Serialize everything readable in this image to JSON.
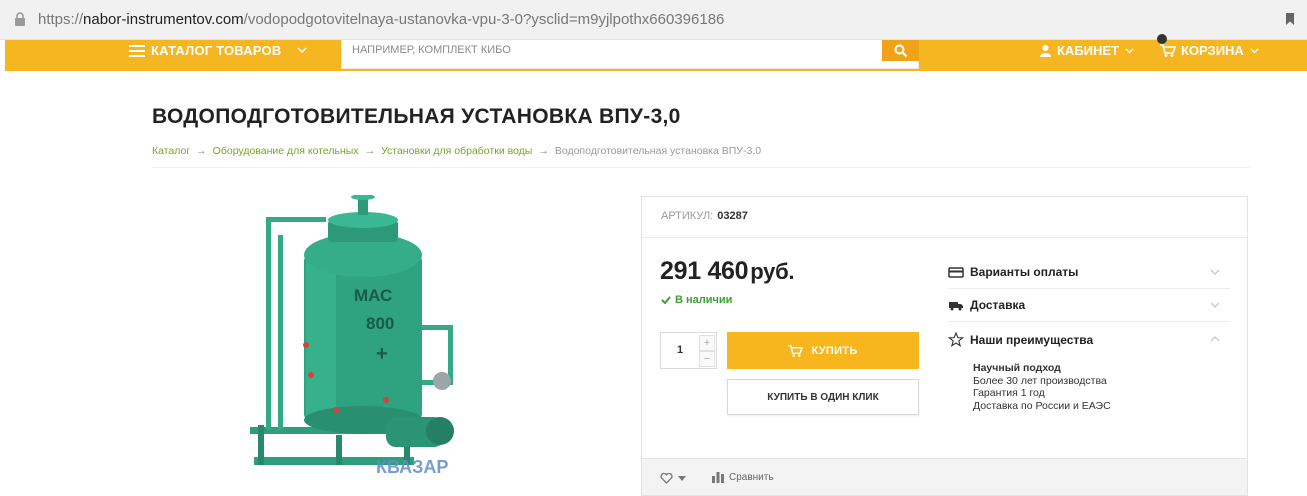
{
  "browser": {
    "url_scheme": "https://",
    "url_host": "nabor-instrumentov.com",
    "url_path": "/vodopodgotovitelnaya-ustanovka-vpu-3-0?ysclid=m9yjlpothx660396186"
  },
  "nav": {
    "catalog_label": "КАТАЛОГ ТОВАРОВ",
    "search_placeholder": "НАПРИМЕР, КОМПЛЕКТ КИБО",
    "cabinet_label": "КАБИНЕТ",
    "cart_label": "КОРЗИНА"
  },
  "product": {
    "title": "ВОДОПОДГОТОВИТЕЛЬНАЯ УСТАНОВКА ВПУ-3,0",
    "breadcrumbs": [
      "Каталог",
      "Оборудование для котельных",
      "Установки для обработки воды",
      "Водоподготовительная установка ВПУ-3,0"
    ],
    "breadcrumb_separator": "→",
    "image_text": {
      "tank_label_1": "МАС",
      "tank_label_2": "800",
      "tank_label_3": "+",
      "watermark": "КВАЗАР"
    },
    "sku_label": "АРТИКУЛ:",
    "sku_value": "03287",
    "price": "291 460",
    "currency": "руб.",
    "stock": "В наличии",
    "quantity": "1",
    "qty_plus": "+",
    "qty_minus": "−",
    "buy_label": "КУПИТЬ",
    "one_click_label": "КУПИТЬ В ОДИН КЛИК",
    "options": {
      "payment": "Варианты оплаты",
      "delivery": "Доставка",
      "advantages": "Наши преимущества"
    },
    "advantages_list": [
      "Научный подход",
      "Более 30 лет производства",
      "Гарантия 1 год",
      "Доставка по России и ЕАЭС"
    ],
    "compare_label": "Сравнить"
  },
  "colors": {
    "accent_yellow": "#f6b621",
    "buy_yellow": "#f7b51e",
    "link_green": "#7aa328",
    "stock_green": "#3aa235",
    "tank_green": "#2f9e7c"
  }
}
